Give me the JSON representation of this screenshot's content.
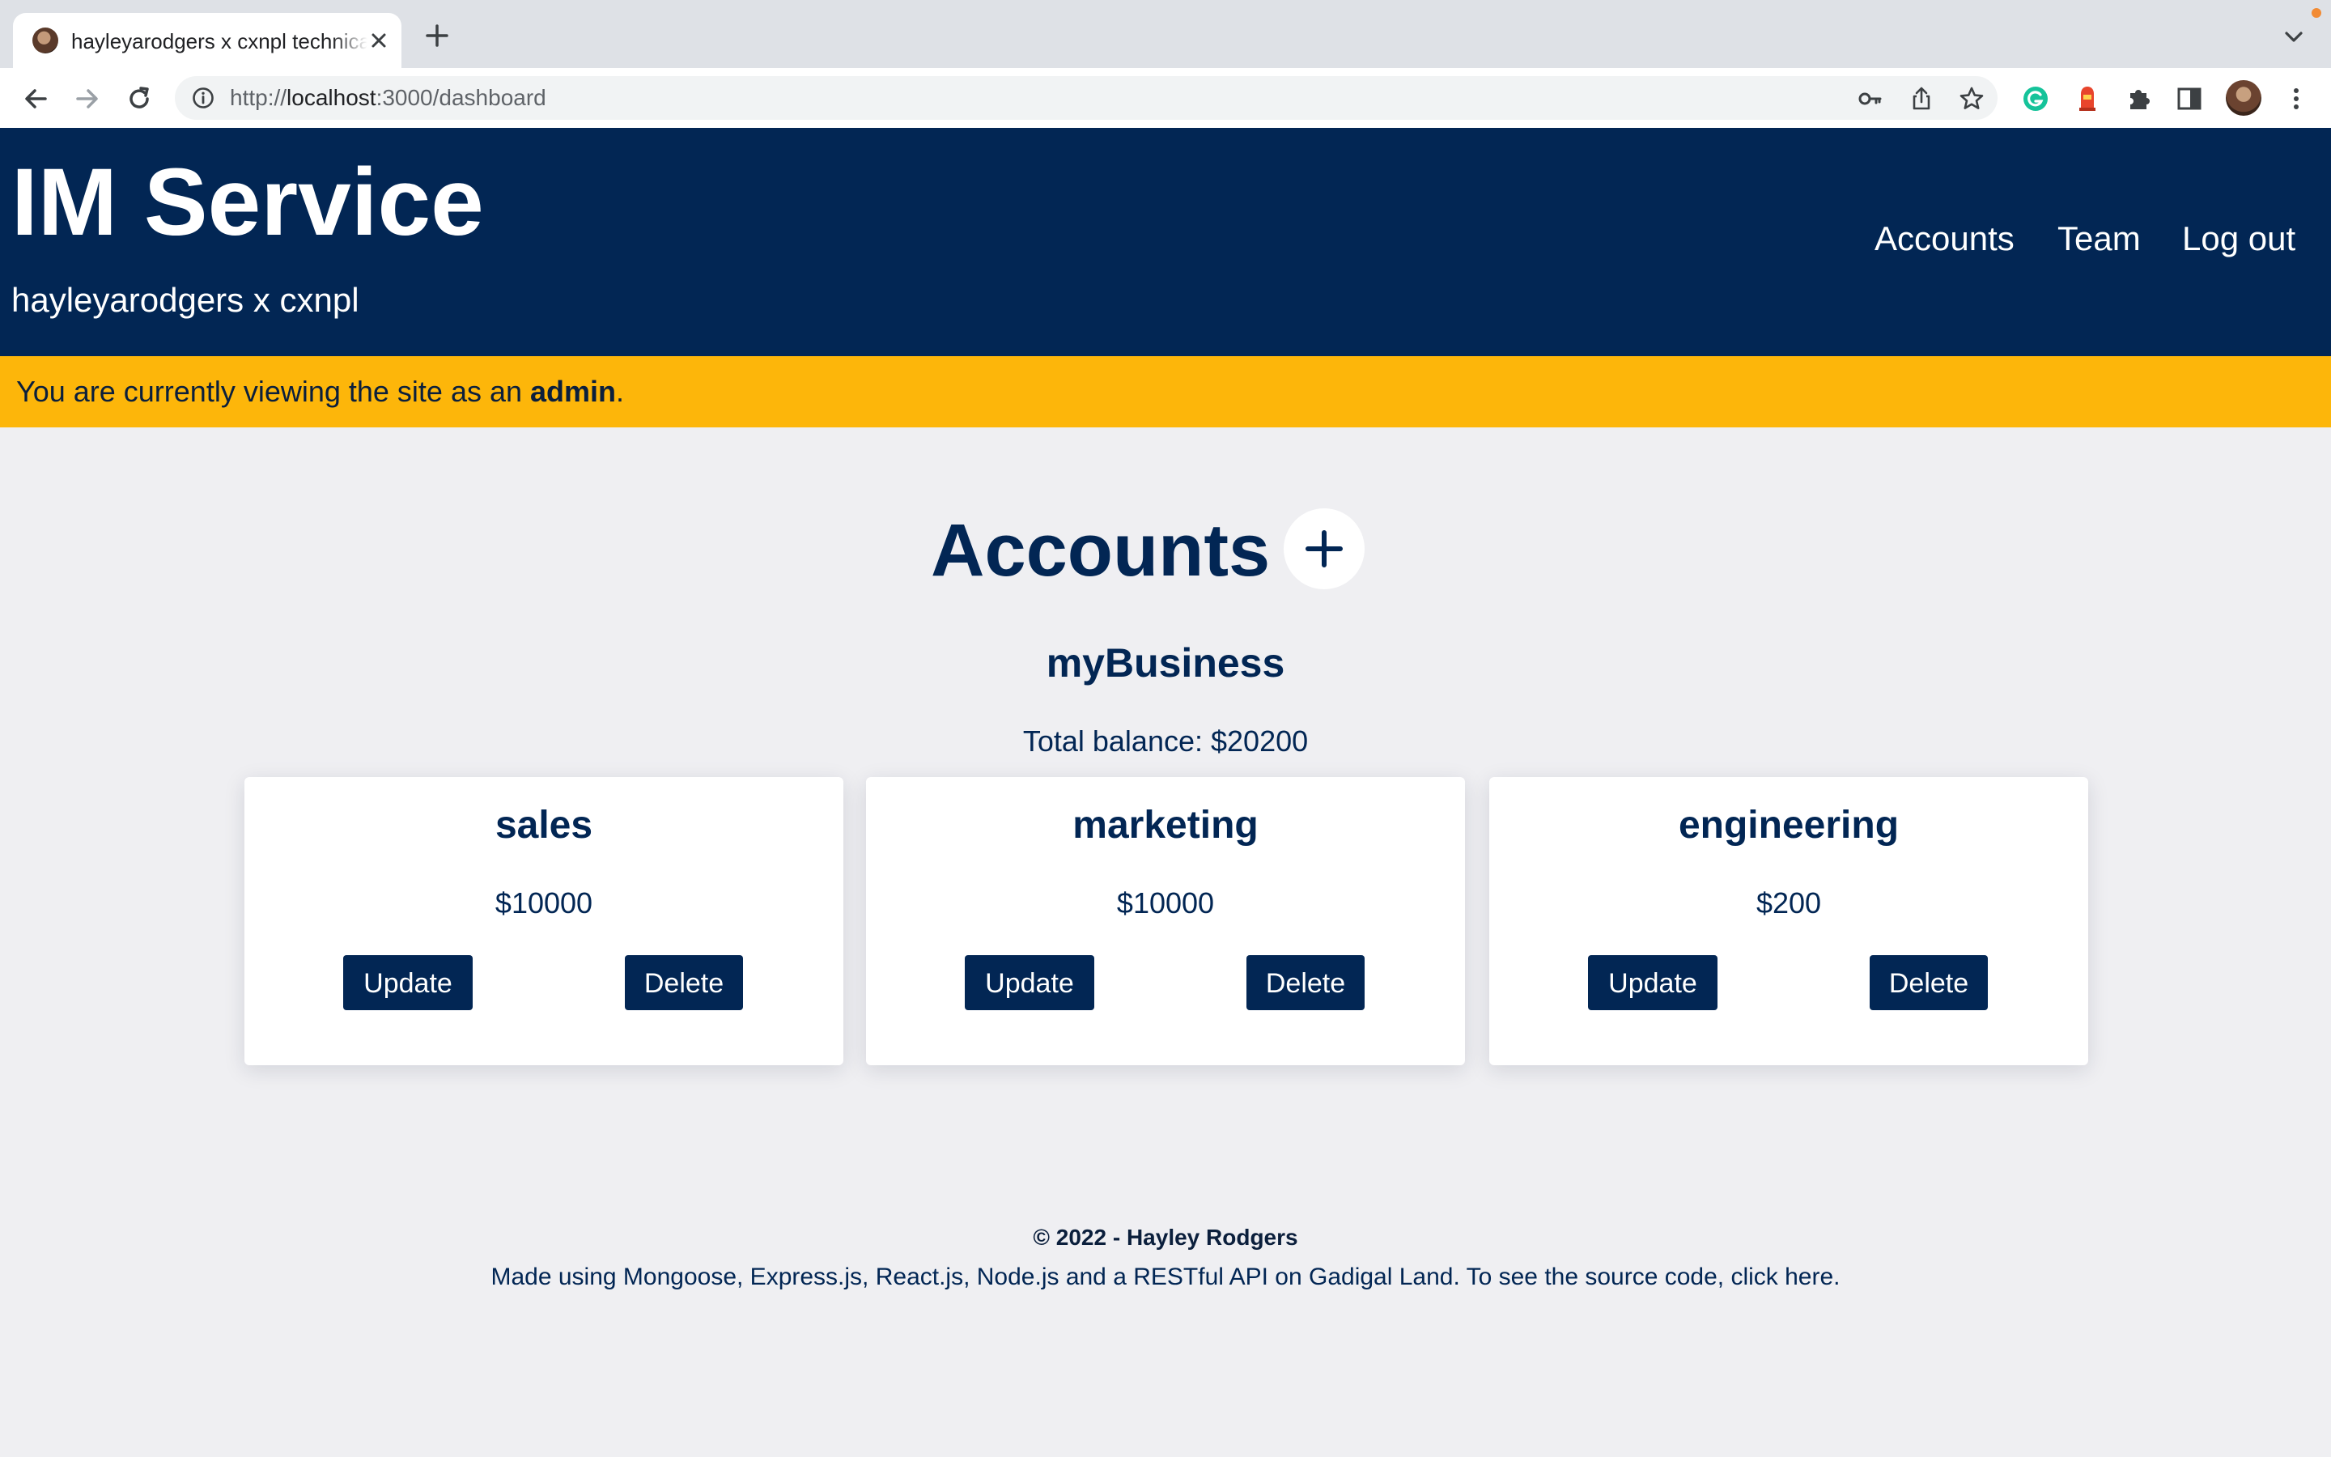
{
  "browser": {
    "tab_title": "hayleyarodgers x cxnpl technical",
    "url_scheme": "http://",
    "url_host": "localhost",
    "url_rest": ":3000/dashboard"
  },
  "header": {
    "title": "IM Service",
    "subtitle": "hayleyarodgers x cxnpl",
    "nav": [
      "Accounts",
      "Team",
      "Log out"
    ]
  },
  "banner": {
    "prefix": "You are currently viewing the site as an ",
    "role": "admin",
    "suffix": "."
  },
  "main": {
    "heading": "Accounts",
    "add_symbol": "+",
    "business_name": "myBusiness",
    "total_balance": "Total balance: $20200",
    "accounts": [
      {
        "name": "sales",
        "balance": "$10000",
        "update_label": "Update",
        "delete_label": "Delete"
      },
      {
        "name": "marketing",
        "balance": "$10000",
        "update_label": "Update",
        "delete_label": "Delete"
      },
      {
        "name": "engineering",
        "balance": "$200",
        "update_label": "Update",
        "delete_label": "Delete"
      }
    ]
  },
  "footer": {
    "copyright": "© 2022 - Hayley Rodgers",
    "made_with": "Made using Mongoose, Express.js, React.js, Node.js and a RESTful API on Gadigal Land. To see the source code, click here."
  },
  "colors": {
    "navy": "#022654",
    "banner_yellow": "#fdb60a",
    "page_bg": "#efeff2"
  },
  "icons": [
    "back-arrow-icon",
    "forward-arrow-icon",
    "reload-icon",
    "info-icon",
    "key-icon",
    "share-icon",
    "star-icon",
    "grammarly-icon",
    "extension-red-icon",
    "puzzle-icon",
    "sidepanel-icon",
    "menu-dots-icon",
    "plus-icon",
    "close-icon",
    "chevron-down-icon"
  ]
}
